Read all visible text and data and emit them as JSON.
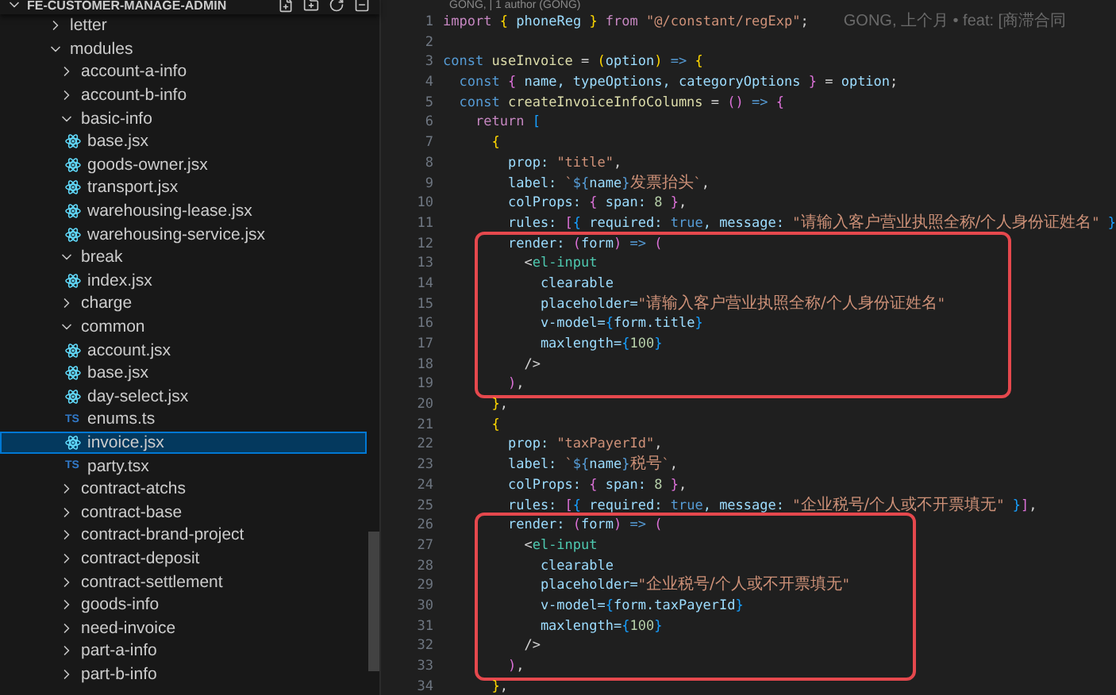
{
  "explorer": {
    "title": "FE-CUSTOMER-MANAGE-ADMIN",
    "expanded": true,
    "items": [
      {
        "label": "letter",
        "kind": "folder",
        "expanded": false,
        "selected": false
      },
      {
        "label": "modules",
        "kind": "folder",
        "expanded": true,
        "selected": false,
        "children": [
          {
            "label": "account-a-info",
            "kind": "folder",
            "expanded": false,
            "selected": false
          },
          {
            "label": "account-b-info",
            "kind": "folder",
            "expanded": false,
            "selected": false
          },
          {
            "label": "basic-info",
            "kind": "folder",
            "expanded": true,
            "selected": false,
            "children": [
              {
                "label": "base.jsx",
                "kind": "jsx",
                "selected": false
              },
              {
                "label": "goods-owner.jsx",
                "kind": "jsx",
                "selected": false
              },
              {
                "label": "transport.jsx",
                "kind": "jsx",
                "selected": false
              },
              {
                "label": "warehousing-lease.jsx",
                "kind": "jsx",
                "selected": false
              },
              {
                "label": "warehousing-service.jsx",
                "kind": "jsx",
                "selected": false
              }
            ]
          },
          {
            "label": "break",
            "kind": "folder",
            "expanded": true,
            "selected": false,
            "children": [
              {
                "label": "index.jsx",
                "kind": "jsx",
                "selected": false
              }
            ]
          },
          {
            "label": "charge",
            "kind": "folder",
            "expanded": false,
            "selected": false
          },
          {
            "label": "common",
            "kind": "folder",
            "expanded": true,
            "selected": false,
            "children": [
              {
                "label": "account.jsx",
                "kind": "jsx",
                "selected": false
              },
              {
                "label": "base.jsx",
                "kind": "jsx",
                "selected": false
              },
              {
                "label": "day-select.jsx",
                "kind": "jsx",
                "selected": false
              },
              {
                "label": "enums.ts",
                "kind": "ts",
                "badge": "TS",
                "selected": false
              },
              {
                "label": "invoice.jsx",
                "kind": "jsx",
                "selected": true
              },
              {
                "label": "party.tsx",
                "kind": "ts",
                "badge": "TS",
                "selected": false
              }
            ]
          },
          {
            "label": "contract-atchs",
            "kind": "folder",
            "expanded": false,
            "selected": false
          },
          {
            "label": "contract-base",
            "kind": "folder",
            "expanded": false,
            "selected": false
          },
          {
            "label": "contract-brand-project",
            "kind": "folder",
            "expanded": false,
            "selected": false
          },
          {
            "label": "contract-deposit",
            "kind": "folder",
            "expanded": false,
            "selected": false
          },
          {
            "label": "contract-settlement",
            "kind": "folder",
            "expanded": false,
            "selected": false
          },
          {
            "label": "goods-info",
            "kind": "folder",
            "expanded": false,
            "selected": false
          },
          {
            "label": "need-invoice",
            "kind": "folder",
            "expanded": false,
            "selected": false
          },
          {
            "label": "part-a-info",
            "kind": "folder",
            "expanded": false,
            "selected": false
          },
          {
            "label": "part-b-info",
            "kind": "folder",
            "expanded": false,
            "selected": false
          }
        ]
      }
    ]
  },
  "editor": {
    "codelens": "GONG, | 1 author (GONG)",
    "blocks": [
      {
        "boxed": false,
        "lines": [
          {
            "number": "1",
            "blame": "GONG, 上个月 • feat: [商滞合同",
            "tokens": [
              {
                "kind": "ctl",
                "text": "import"
              },
              {
                "kind": "b1",
                "text": " {"
              },
              {
                "kind": "var",
                "text": " phoneReg "
              },
              {
                "kind": "b1",
                "text": "}"
              },
              {
                "kind": "ctl",
                "text": " from "
              },
              {
                "kind": "str",
                "text": "\"@/constant/regExp\""
              },
              {
                "kind": "p",
                "text": ";"
              }
            ]
          },
          {
            "number": "2"
          },
          {
            "number": "3",
            "tokens": [
              {
                "kind": "kw",
                "text": "const"
              },
              {
                "kind": "fn",
                "text": " useInvoice"
              },
              {
                "kind": "p",
                "text": " = "
              },
              {
                "kind": "b1",
                "text": "("
              },
              {
                "kind": "var",
                "text": "option"
              },
              {
                "kind": "b1",
                "text": ")"
              },
              {
                "kind": "kw",
                "text": " => "
              },
              {
                "kind": "b1",
                "text": "{"
              }
            ]
          },
          {
            "number": "4",
            "tokens": [
              {
                "kind": "kw",
                "text": "  const"
              },
              {
                "kind": "b2",
                "text": " {"
              },
              {
                "kind": "var",
                "text": " name, typeOptions, categoryOptions "
              },
              {
                "kind": "b2",
                "text": "}"
              },
              {
                "kind": "p",
                "text": " = "
              },
              {
                "kind": "var",
                "text": "option"
              },
              {
                "kind": "p",
                "text": ";"
              }
            ]
          },
          {
            "number": "5",
            "tokens": [
              {
                "kind": "kw",
                "text": "  const"
              },
              {
                "kind": "fn",
                "text": " createInvoiceInfoColumns"
              },
              {
                "kind": "p",
                "text": " = "
              },
              {
                "kind": "b2",
                "text": "()"
              },
              {
                "kind": "kw",
                "text": " => "
              },
              {
                "kind": "b2",
                "text": "{"
              }
            ]
          },
          {
            "number": "6",
            "tokens": [
              {
                "kind": "ctl",
                "text": "    return"
              },
              {
                "kind": "b3",
                "text": " ["
              }
            ]
          },
          {
            "number": "7",
            "tokens": [
              {
                "kind": "b1",
                "text": "      {"
              }
            ]
          },
          {
            "number": "8",
            "tokens": [
              {
                "kind": "var",
                "text": "        prop: "
              },
              {
                "kind": "str",
                "text": "\"title\""
              },
              {
                "kind": "p",
                "text": ","
              }
            ]
          },
          {
            "number": "9",
            "tokens": [
              {
                "kind": "var",
                "text": "        label: "
              },
              {
                "kind": "str",
                "text": "`"
              },
              {
                "kind": "kw",
                "text": "${"
              },
              {
                "kind": "var",
                "text": "name"
              },
              {
                "kind": "kw",
                "text": "}"
              },
              {
                "kind": "cjk",
                "text": "发票抬头"
              },
              {
                "kind": "str",
                "text": "`"
              },
              {
                "kind": "p",
                "text": ","
              }
            ]
          },
          {
            "number": "10",
            "tokens": [
              {
                "kind": "var",
                "text": "        colProps: "
              },
              {
                "kind": "b2",
                "text": "{"
              },
              {
                "kind": "var",
                "text": " span: "
              },
              {
                "kind": "num",
                "text": "8"
              },
              {
                "kind": "b2",
                "text": " }"
              },
              {
                "kind": "p",
                "text": ","
              }
            ]
          },
          {
            "number": "11",
            "tokens": [
              {
                "kind": "var",
                "text": "        rules: "
              },
              {
                "kind": "b2",
                "text": "["
              },
              {
                "kind": "b3",
                "text": "{"
              },
              {
                "kind": "var",
                "text": " required: "
              },
              {
                "kind": "kw",
                "text": "true"
              },
              {
                "kind": "var",
                "text": ", message: "
              },
              {
                "kind": "str",
                "text": "\""
              },
              {
                "kind": "cjk",
                "text": "请输入客户营业执照全称/个人身份证姓名"
              },
              {
                "kind": "str",
                "text": "\""
              },
              {
                "kind": "b3",
                "text": " }"
              }
            ]
          }
        ]
      },
      {
        "boxed": true,
        "lines": [
          {
            "number": "12",
            "tokens": [
              {
                "kind": "var",
                "text": "        render: "
              },
              {
                "kind": "b2",
                "text": "("
              },
              {
                "kind": "var",
                "text": "form"
              },
              {
                "kind": "b2",
                "text": ")"
              },
              {
                "kind": "kw",
                "text": " => "
              },
              {
                "kind": "b2",
                "text": "("
              }
            ]
          },
          {
            "number": "13",
            "tokens": [
              {
                "kind": "p",
                "text": "          <"
              },
              {
                "kind": "tag",
                "text": "el-input"
              }
            ]
          },
          {
            "number": "14",
            "tokens": [
              {
                "kind": "var",
                "text": "            clearable"
              }
            ]
          },
          {
            "number": "15",
            "tokens": [
              {
                "kind": "var",
                "text": "            placeholder="
              },
              {
                "kind": "str",
                "text": "\""
              },
              {
                "kind": "cjk",
                "text": "请输入客户营业执照全称/个人身份证姓名"
              },
              {
                "kind": "str",
                "text": "\""
              }
            ]
          },
          {
            "number": "16",
            "tokens": [
              {
                "kind": "var",
                "text": "            v-model="
              },
              {
                "kind": "b3",
                "text": "{"
              },
              {
                "kind": "var",
                "text": "form.title"
              },
              {
                "kind": "b3",
                "text": "}"
              }
            ]
          },
          {
            "number": "17",
            "tokens": [
              {
                "kind": "var",
                "text": "            maxlength="
              },
              {
                "kind": "b3",
                "text": "{"
              },
              {
                "kind": "num",
                "text": "100"
              },
              {
                "kind": "b3",
                "text": "}"
              }
            ]
          },
          {
            "number": "18",
            "tokens": [
              {
                "kind": "p",
                "text": "          />"
              }
            ]
          },
          {
            "number": "19",
            "tokens": [
              {
                "kind": "b2",
                "text": "        )"
              },
              {
                "kind": "p",
                "text": ","
              }
            ]
          }
        ]
      },
      {
        "boxed": false,
        "lines": [
          {
            "number": "20",
            "tokens": [
              {
                "kind": "b1",
                "text": "      }"
              },
              {
                "kind": "p",
                "text": ","
              }
            ]
          },
          {
            "number": "21",
            "tokens": [
              {
                "kind": "b1",
                "text": "      {"
              }
            ]
          },
          {
            "number": "22",
            "tokens": [
              {
                "kind": "var",
                "text": "        prop: "
              },
              {
                "kind": "str",
                "text": "\"taxPayerId\""
              },
              {
                "kind": "p",
                "text": ","
              }
            ]
          },
          {
            "number": "23",
            "tokens": [
              {
                "kind": "var",
                "text": "        label: "
              },
              {
                "kind": "str",
                "text": "`"
              },
              {
                "kind": "kw",
                "text": "${"
              },
              {
                "kind": "var",
                "text": "name"
              },
              {
                "kind": "kw",
                "text": "}"
              },
              {
                "kind": "cjk",
                "text": "税号"
              },
              {
                "kind": "str",
                "text": "`"
              },
              {
                "kind": "p",
                "text": ","
              }
            ]
          },
          {
            "number": "24",
            "tokens": [
              {
                "kind": "var",
                "text": "        colProps: "
              },
              {
                "kind": "b2",
                "text": "{"
              },
              {
                "kind": "var",
                "text": " span: "
              },
              {
                "kind": "num",
                "text": "8"
              },
              {
                "kind": "b2",
                "text": " }"
              },
              {
                "kind": "p",
                "text": ","
              }
            ]
          },
          {
            "number": "25",
            "tokens": [
              {
                "kind": "var",
                "text": "        rules: "
              },
              {
                "kind": "b2",
                "text": "["
              },
              {
                "kind": "b3",
                "text": "{"
              },
              {
                "kind": "var",
                "text": " required: "
              },
              {
                "kind": "kw",
                "text": "true"
              },
              {
                "kind": "var",
                "text": ", message: "
              },
              {
                "kind": "str",
                "text": "\""
              },
              {
                "kind": "cjk",
                "text": "企业税号/个人或不开票填无"
              },
              {
                "kind": "str",
                "text": "\""
              },
              {
                "kind": "b3",
                "text": " }"
              },
              {
                "kind": "b2",
                "text": "]"
              },
              {
                "kind": "p",
                "text": ","
              }
            ]
          }
        ]
      },
      {
        "boxed": true,
        "lines": [
          {
            "number": "26",
            "tokens": [
              {
                "kind": "var",
                "text": "        render: "
              },
              {
                "kind": "b2",
                "text": "("
              },
              {
                "kind": "var",
                "text": "form"
              },
              {
                "kind": "b2",
                "text": ")"
              },
              {
                "kind": "kw",
                "text": " => "
              },
              {
                "kind": "b2",
                "text": "("
              }
            ]
          },
          {
            "number": "27",
            "tokens": [
              {
                "kind": "p",
                "text": "          <"
              },
              {
                "kind": "tag",
                "text": "el-input"
              }
            ]
          },
          {
            "number": "28",
            "tokens": [
              {
                "kind": "var",
                "text": "            clearable"
              }
            ]
          },
          {
            "number": "29",
            "tokens": [
              {
                "kind": "var",
                "text": "            placeholder="
              },
              {
                "kind": "str",
                "text": "\""
              },
              {
                "kind": "cjk",
                "text": "企业税号/个人或不开票填无"
              },
              {
                "kind": "str",
                "text": "\""
              }
            ]
          },
          {
            "number": "30",
            "tokens": [
              {
                "kind": "var",
                "text": "            v-model="
              },
              {
                "kind": "b3",
                "text": "{"
              },
              {
                "kind": "var",
                "text": "form.taxPayerId"
              },
              {
                "kind": "b3",
                "text": "}"
              }
            ]
          },
          {
            "number": "31",
            "tokens": [
              {
                "kind": "var",
                "text": "            maxlength="
              },
              {
                "kind": "b3",
                "text": "{"
              },
              {
                "kind": "num",
                "text": "100"
              },
              {
                "kind": "b3",
                "text": "}"
              }
            ]
          },
          {
            "number": "32",
            "tokens": [
              {
                "kind": "p",
                "text": "          />"
              }
            ]
          },
          {
            "number": "33",
            "tokens": [
              {
                "kind": "b2",
                "text": "        )"
              },
              {
                "kind": "p",
                "text": ","
              }
            ]
          }
        ]
      },
      {
        "boxed": false,
        "lines": [
          {
            "number": "34",
            "tokens": [
              {
                "kind": "b1",
                "text": "      }"
              },
              {
                "kind": "p",
                "text": ","
              }
            ]
          }
        ]
      }
    ]
  }
}
